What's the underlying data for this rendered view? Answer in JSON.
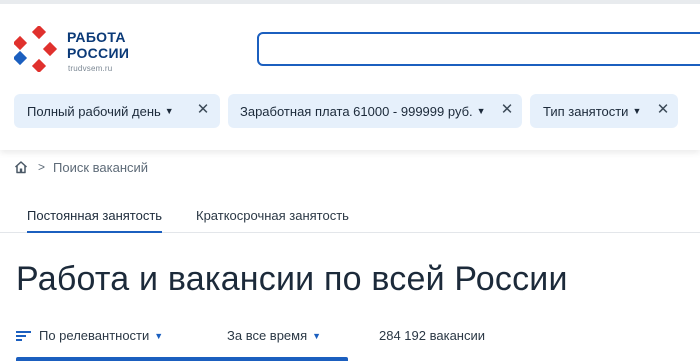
{
  "logo": {
    "line1": "РАБОТА",
    "line2": "РОССИИ",
    "site": "trudvsem.ru",
    "mark_color_red": "#e0312d",
    "mark_color_blue": "#1b5fbf"
  },
  "search": {
    "value": "",
    "placeholder": ""
  },
  "filters": [
    {
      "label": "Полный рабочий день",
      "caret": "▼",
      "remove": "✕"
    },
    {
      "label": "Заработная плата 61000 - 999999 руб.",
      "caret": "▼",
      "remove": "✕"
    },
    {
      "label": "Тип занятости",
      "caret": "▼",
      "remove": "✕"
    }
  ],
  "breadcrumb": {
    "home_icon": "home-icon",
    "separator": ">",
    "current": "Поиск вакансий"
  },
  "tabs": [
    {
      "label": "Постоянная занятость",
      "active": true
    },
    {
      "label": "Краткосрочная занятость",
      "active": false
    }
  ],
  "page_title": "Работа и вакансии по всей России",
  "controls": {
    "sort_icon": "sort-icon",
    "sort_label": "По релевантности",
    "period_label": "За все время",
    "caret": "▼",
    "count": "284 192 вакансии"
  },
  "colors": {
    "accent": "#1b5fbf",
    "chip_bg": "#e6f0fb",
    "text": "#1c2a3a"
  }
}
